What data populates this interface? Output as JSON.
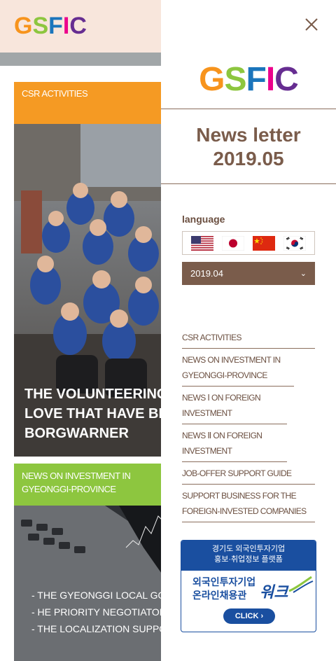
{
  "site": {
    "logo_letters": [
      {
        "char": "G",
        "color": "#f7941d"
      },
      {
        "char": "S",
        "color": "#8dc63f"
      },
      {
        "char": "F",
        "color": "#1b75bc"
      },
      {
        "char": "I",
        "color": "#ec008c"
      },
      {
        "char": "C",
        "color": "#662d91"
      }
    ]
  },
  "cards": [
    {
      "category": "CSR ACTIVITIES",
      "category_color": "#f59a23",
      "title_lines": [
        "THE VOLUNTEERING A",
        "LOVE THAT HAVE BEEN",
        "BORGWARNER"
      ]
    },
    {
      "category": "NEWS ON INVESTMENT IN GYEONGGI-PROVINCE",
      "category_color": "#8dc63f",
      "bullets": [
        "- THE GYEONGGI LOCAL GOV",
        "- HE PRIORITY NEGOTIATOR",
        "- THE LOCALIZATION SUPPO"
      ]
    }
  ],
  "panel": {
    "close_icon": "close-icon",
    "newsletter_title": "News letter",
    "newsletter_issue": "2019.05",
    "language_label": "language",
    "flags": [
      "us-flag-icon",
      "japan-flag-icon",
      "china-flag-icon",
      "korea-flag-icon"
    ],
    "issue_select_value": "2019.04",
    "menu": [
      "CSR ACTIVITIES",
      "NEWS ON INVESTMENT IN GYEONGGI-PROVINCE",
      "NEWS Ⅰ ON FOREIGN INVESTMENT",
      "NEWS Ⅱ ON FOREIGN INVESTMENT",
      "JOB-OFFER SUPPORT GUIDE",
      "SUPPORT BUSINESS FOR THE FOREIGN-INVESTED COMPANIES"
    ],
    "banner": {
      "top_line1": "경기도 외국인투자기업",
      "top_line2": "홍보·취업정보 플랫폼",
      "mid_line1": "외국인투자기업",
      "mid_line2": "온라인채용관",
      "brand": "워크",
      "click_label": "CLICK"
    }
  },
  "colors": {
    "accent_brown": "#7a5c4b",
    "header_bg": "#f8e6dc",
    "banner_blue": "#1a4fa0"
  }
}
